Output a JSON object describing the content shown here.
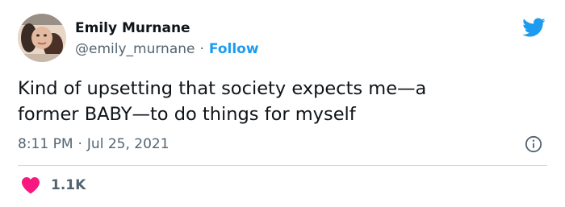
{
  "tweet": {
    "author": {
      "name": "Emily Murnane",
      "handle": "@emily_murnane",
      "separator": "·",
      "follow_label": "Follow"
    },
    "text": "Kind of upsetting that society expects me—a\nformer BABY—to do things for myself",
    "time": "8:11 PM",
    "time_separator": "·",
    "date": "Jul 25, 2021",
    "likes_count": "1.1K"
  },
  "icons": {
    "brand": "twitter-bird-icon",
    "info": "info-icon",
    "like": "heart-icon"
  },
  "colors": {
    "accent": "#1d9bf0",
    "like": "#f91880",
    "text": "#0f1419",
    "muted": "#536471",
    "divider": "#cfd9de"
  }
}
